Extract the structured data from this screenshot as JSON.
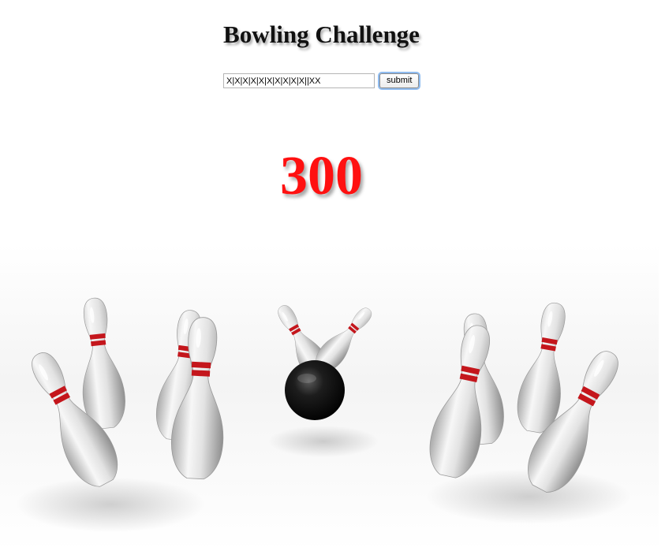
{
  "page": {
    "title": "Bowling Challenge"
  },
  "form": {
    "input_value": "X|X|X|X|X|X|X|X|X|X||XX",
    "submit_label": "submit"
  },
  "result": {
    "score": "300",
    "score_color": "#ff1010"
  },
  "illustration": {
    "subject": "bowling pins scattered around a black bowling ball",
    "pin_stripe_color": "#c4161c",
    "ball_color": "#111111"
  }
}
